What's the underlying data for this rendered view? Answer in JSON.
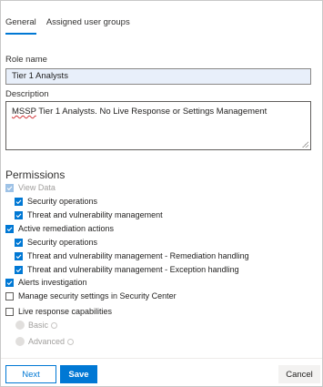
{
  "tabs": [
    {
      "label": "General"
    },
    {
      "label": "Assigned user groups"
    }
  ],
  "role_name": {
    "label": "Role name",
    "value": "Tier 1 Analysts"
  },
  "description": {
    "label": "Description",
    "value_prefix": "MSSP",
    "value_rest": " Tier 1 Analysts.  No Live Response or Settings Management"
  },
  "permissions": {
    "title": "Permissions",
    "view_data": "View Data",
    "security_operations": "Security operations",
    "threat_vuln_mgmt": "Threat and vulnerability management",
    "active_remediation": "Active remediation actions",
    "ar_security_operations": "Security operations",
    "ar_remediation_handling": "Threat and vulnerability management - Remediation handling",
    "ar_exception_handling": "Threat and vulnerability management - Exception handling",
    "alerts_investigation": "Alerts investigation",
    "manage_security_settings": "Manage security settings in Security Center",
    "live_response": "Live response capabilities",
    "basic": "Basic",
    "advanced": "Advanced"
  },
  "buttons": {
    "next": "Next",
    "save": "Save",
    "cancel": "Cancel"
  },
  "colors": {
    "accent": "#0078d4",
    "field_highlight": "#e8effa"
  }
}
